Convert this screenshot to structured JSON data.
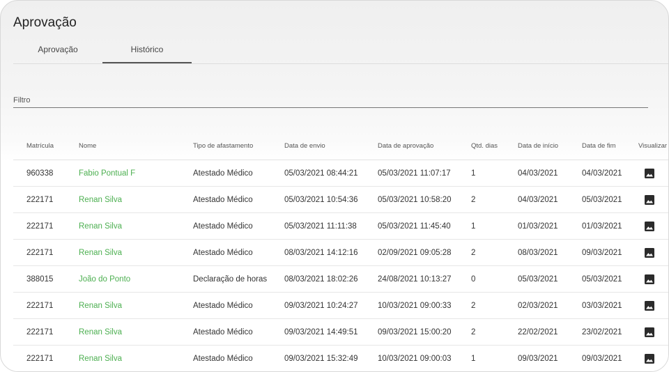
{
  "page": {
    "title": "Aprovação"
  },
  "tabs": [
    {
      "label": "Aprovação",
      "active": false
    },
    {
      "label": "Histórico",
      "active": true
    }
  ],
  "filter": {
    "label": "Filtro"
  },
  "table": {
    "columns": [
      "Matrícula",
      "Nome",
      "Tipo de afastamento",
      "Data de envio",
      "Data de aprovação",
      "Qtd. dias",
      "Data de início",
      "Data de fim",
      "Visualizar"
    ],
    "rows": [
      {
        "matricula": "960338",
        "nome": "Fabio Pontual F",
        "tipo": "Atestado Médico",
        "envio": "05/03/2021 08:44:21",
        "aprovacao": "05/03/2021 11:07:17",
        "dias": "1",
        "inicio": "04/03/2021",
        "fim": "04/03/2021"
      },
      {
        "matricula": "222171",
        "nome": "Renan Silva",
        "tipo": "Atestado Médico",
        "envio": "05/03/2021 10:54:36",
        "aprovacao": "05/03/2021 10:58:20",
        "dias": "2",
        "inicio": "04/03/2021",
        "fim": "05/03/2021"
      },
      {
        "matricula": "222171",
        "nome": "Renan Silva",
        "tipo": "Atestado Médico",
        "envio": "05/03/2021 11:11:38",
        "aprovacao": "05/03/2021 11:45:40",
        "dias": "1",
        "inicio": "01/03/2021",
        "fim": "01/03/2021"
      },
      {
        "matricula": "222171",
        "nome": "Renan Silva",
        "tipo": "Atestado Médico",
        "envio": "08/03/2021 14:12:16",
        "aprovacao": "02/09/2021 09:05:28",
        "dias": "2",
        "inicio": "08/03/2021",
        "fim": "09/03/2021"
      },
      {
        "matricula": "388015",
        "nome": "João do Ponto",
        "tipo": "Declaração de horas",
        "envio": "08/03/2021 18:02:26",
        "aprovacao": "24/08/2021 10:13:27",
        "dias": "0",
        "inicio": "05/03/2021",
        "fim": "05/03/2021"
      },
      {
        "matricula": "222171",
        "nome": "Renan Silva",
        "tipo": "Atestado Médico",
        "envio": "09/03/2021 10:24:27",
        "aprovacao": "10/03/2021 09:00:33",
        "dias": "2",
        "inicio": "02/03/2021",
        "fim": "03/03/2021"
      },
      {
        "matricula": "222171",
        "nome": "Renan Silva",
        "tipo": "Atestado Médico",
        "envio": "09/03/2021 14:49:51",
        "aprovacao": "09/03/2021 15:00:20",
        "dias": "2",
        "inicio": "22/02/2021",
        "fim": "23/02/2021"
      },
      {
        "matricula": "222171",
        "nome": "Renan Silva",
        "tipo": "Atestado Médico",
        "envio": "09/03/2021 15:32:49",
        "aprovacao": "10/03/2021 09:00:03",
        "dias": "1",
        "inicio": "09/03/2021",
        "fim": "09/03/2021"
      }
    ]
  },
  "icons": {
    "view": "image-icon"
  },
  "colors": {
    "name_link": "#4caf50",
    "active_tab_underline": "#555555"
  }
}
